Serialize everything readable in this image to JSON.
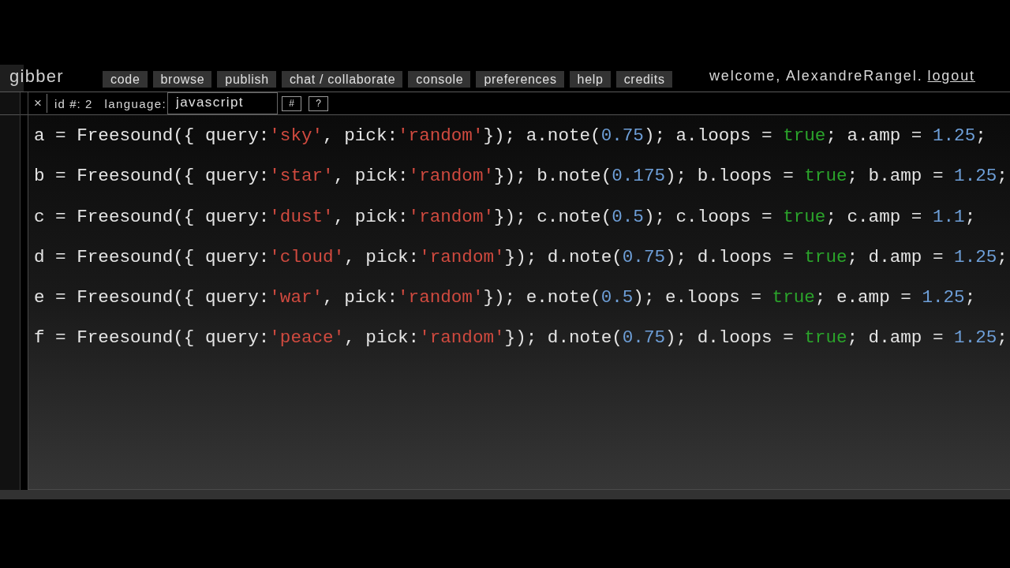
{
  "header": {
    "logo": "gibber",
    "nav": [
      {
        "label": "code"
      },
      {
        "label": "browse"
      },
      {
        "label": "publish"
      },
      {
        "label": "chat / collaborate"
      },
      {
        "label": "console"
      },
      {
        "label": "preferences"
      },
      {
        "label": "help"
      },
      {
        "label": "credits"
      }
    ],
    "welcome": "welcome, AlexandreRangel.",
    "logout": "logout"
  },
  "editor": {
    "close": "×",
    "id_label": "id #: 2",
    "language_label": "language:",
    "language_field": {
      "value": "javascript"
    },
    "buttons": [
      "#",
      "?"
    ],
    "code_lines": [
      {
        "tokens": [
          {
            "kind": "plain",
            "text": "a = Freesound({ query:"
          },
          {
            "kind": "string",
            "text": "'sky'"
          },
          {
            "kind": "plain",
            "text": ", pick:"
          },
          {
            "kind": "string",
            "text": "'random'"
          },
          {
            "kind": "plain",
            "text": "}); a.note("
          },
          {
            "kind": "number",
            "text": "0.75"
          },
          {
            "kind": "plain",
            "text": "); a.loops = "
          },
          {
            "kind": "keyword",
            "text": "true"
          },
          {
            "kind": "plain",
            "text": "; a.amp = "
          },
          {
            "kind": "number",
            "text": "1.25"
          },
          {
            "kind": "plain",
            "text": ";"
          }
        ]
      },
      {
        "tokens": [
          {
            "kind": "plain",
            "text": "b = Freesound({ query:"
          },
          {
            "kind": "string",
            "text": "'star'"
          },
          {
            "kind": "plain",
            "text": ", pick:"
          },
          {
            "kind": "string",
            "text": "'random'"
          },
          {
            "kind": "plain",
            "text": "}); b.note("
          },
          {
            "kind": "number",
            "text": "0.175"
          },
          {
            "kind": "plain",
            "text": "); b.loops = "
          },
          {
            "kind": "keyword",
            "text": "true"
          },
          {
            "kind": "plain",
            "text": "; b.amp = "
          },
          {
            "kind": "number",
            "text": "1.25"
          },
          {
            "kind": "plain",
            "text": ";"
          }
        ]
      },
      {
        "tokens": [
          {
            "kind": "plain",
            "text": "c = Freesound({ query:"
          },
          {
            "kind": "string",
            "text": "'dust'"
          },
          {
            "kind": "plain",
            "text": ", pick:"
          },
          {
            "kind": "string",
            "text": "'random'"
          },
          {
            "kind": "plain",
            "text": "}); c.note("
          },
          {
            "kind": "number",
            "text": "0.5"
          },
          {
            "kind": "plain",
            "text": "); c.loops = "
          },
          {
            "kind": "keyword",
            "text": "true"
          },
          {
            "kind": "plain",
            "text": "; c.amp = "
          },
          {
            "kind": "number",
            "text": "1.1"
          },
          {
            "kind": "plain",
            "text": ";"
          }
        ]
      },
      {
        "tokens": [
          {
            "kind": "plain",
            "text": "d = Freesound({ query:"
          },
          {
            "kind": "string",
            "text": "'cloud'"
          },
          {
            "kind": "plain",
            "text": ", pick:"
          },
          {
            "kind": "string",
            "text": "'random'"
          },
          {
            "kind": "plain",
            "text": "}); d.note("
          },
          {
            "kind": "number",
            "text": "0.75"
          },
          {
            "kind": "plain",
            "text": "); d.loops = "
          },
          {
            "kind": "keyword",
            "text": "true"
          },
          {
            "kind": "plain",
            "text": "; d.amp = "
          },
          {
            "kind": "number",
            "text": "1.25"
          },
          {
            "kind": "plain",
            "text": ";"
          }
        ]
      },
      {
        "tokens": [
          {
            "kind": "plain",
            "text": "e = Freesound({ query:"
          },
          {
            "kind": "string",
            "text": "'war'"
          },
          {
            "kind": "plain",
            "text": ", pick:"
          },
          {
            "kind": "string",
            "text": "'random'"
          },
          {
            "kind": "plain",
            "text": "}); e.note("
          },
          {
            "kind": "number",
            "text": "0.5"
          },
          {
            "kind": "plain",
            "text": "); e.loops = "
          },
          {
            "kind": "keyword",
            "text": "true"
          },
          {
            "kind": "plain",
            "text": "; e.amp = "
          },
          {
            "kind": "number",
            "text": "1.25"
          },
          {
            "kind": "plain",
            "text": ";"
          }
        ]
      },
      {
        "tokens": [
          {
            "kind": "plain",
            "text": "f = Freesound({ query:"
          },
          {
            "kind": "string",
            "text": "'peace'"
          },
          {
            "kind": "plain",
            "text": ", pick:"
          },
          {
            "kind": "string",
            "text": "'random'"
          },
          {
            "kind": "plain",
            "text": "}); d.note("
          },
          {
            "kind": "number",
            "text": "0.75"
          },
          {
            "kind": "plain",
            "text": "); d.loops = "
          },
          {
            "kind": "keyword",
            "text": "true"
          },
          {
            "kind": "plain",
            "text": "; d.amp = "
          },
          {
            "kind": "number",
            "text": "1.25"
          },
          {
            "kind": "plain",
            "text": ";"
          }
        ]
      }
    ]
  }
}
